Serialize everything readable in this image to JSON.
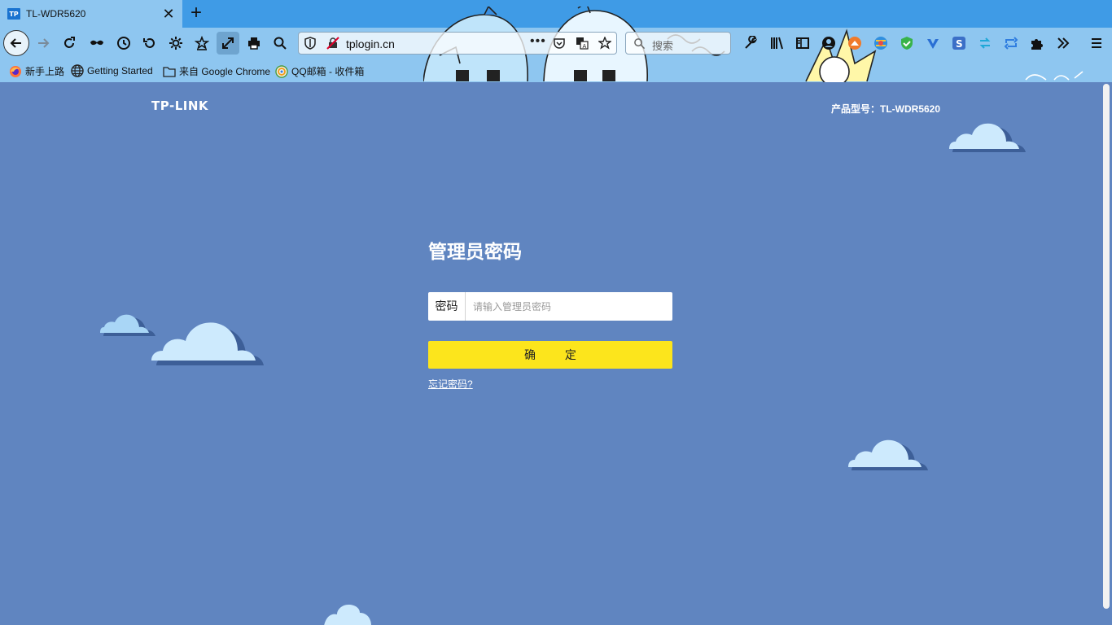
{
  "browser": {
    "tab": {
      "favicon_text": "TP",
      "title": "TL-WDR5620"
    },
    "url": "tplogin.cn",
    "url_actions_dots": "•••",
    "search_placeholder": "搜索",
    "nav_icons": [
      "back-icon",
      "forward-icon",
      "reload-icon",
      "private-mask-icon",
      "history-clock-icon",
      "undo-history-icon",
      "settings-gear-icon",
      "bookmark-star-icon",
      "fullscreen-icon",
      "print-icon",
      "zoom-search-icon"
    ],
    "extension_icons": [
      "wrench-icon",
      "library-icon",
      "sidebar-icon",
      "account-icon",
      "fox-extension-icon",
      "globe-extension-icon",
      "shield-check-icon",
      "vpn-extension-icon",
      "s-extension-icon",
      "sync-extension-icon",
      "repeat-extension-icon",
      "puzzle-icon",
      "overflow-chevron-icon",
      "hamburger-menu-icon"
    ],
    "bookmarks": [
      {
        "icon": "firefox-icon",
        "label": "新手上路"
      },
      {
        "icon": "globe-icon",
        "label": "Getting Started"
      },
      {
        "icon": "folder-icon",
        "label": "来自 Google Chrome"
      },
      {
        "icon": "qq-mail-icon",
        "label": "QQ邮箱 - 收件箱"
      }
    ],
    "theme_colors": {
      "tabbar": "#3f9be6",
      "toolbar": "#8ec6f0"
    }
  },
  "page": {
    "brand": "TP-LINK",
    "model": "产品型号：TL-WDR5620",
    "title": "管理员密码",
    "password_label": "密码",
    "password_placeholder": "请输入管理员密码",
    "password_value": "",
    "confirm_label": "确 定",
    "forgot_link": "忘记密码?",
    "colors": {
      "background": "#6085c0",
      "button": "#fce51c",
      "cloud": "#cdeafd"
    }
  }
}
